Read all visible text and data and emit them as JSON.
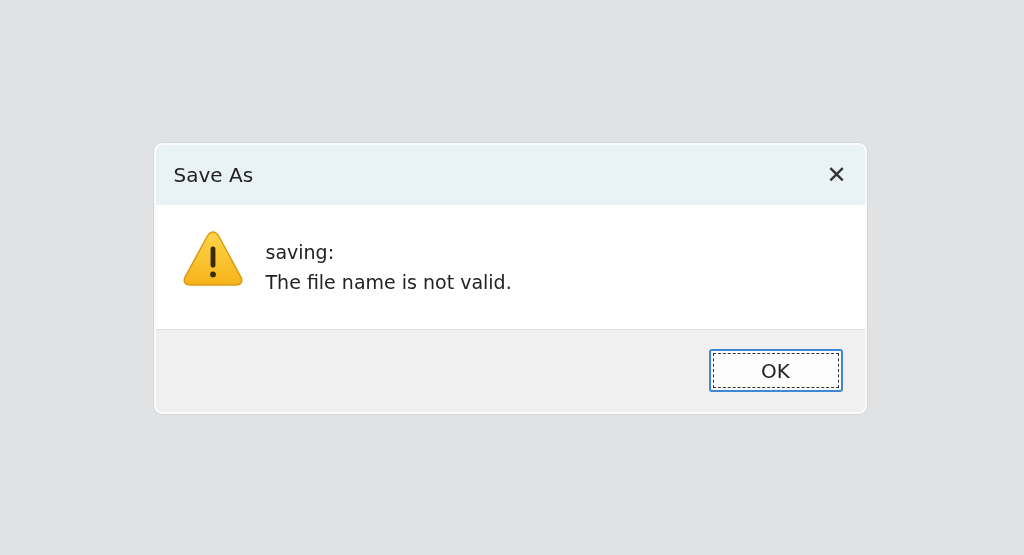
{
  "window": {
    "title": "Save As",
    "close": "✕"
  },
  "message": {
    "lines": [
      "saving:",
      "The file name is not valid."
    ]
  },
  "buttons": [
    {
      "label": "OK",
      "focused": true
    }
  ]
}
